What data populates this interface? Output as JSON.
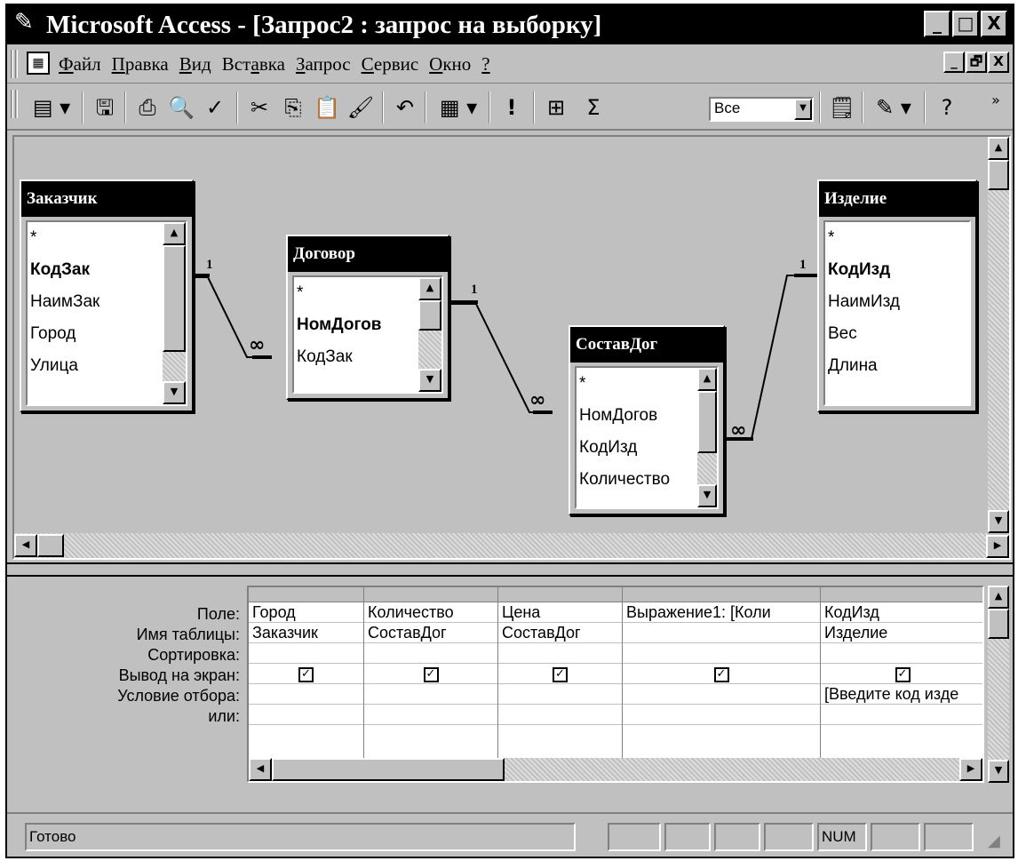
{
  "window": {
    "title": "Microsoft Access - [Запрос2 : запрос на выборку]",
    "caption_buttons": [
      "_",
      "□",
      "X"
    ],
    "mdi_buttons": [
      "_",
      "🗗",
      "X"
    ]
  },
  "menu": {
    "items": [
      {
        "accel": "Ф",
        "rest": "айл"
      },
      {
        "accel": "П",
        "rest": "равка"
      },
      {
        "accel": "В",
        "rest": "ид"
      },
      {
        "pre": "Вст",
        "accel": "а",
        "rest": "вка"
      },
      {
        "accel": "З",
        "rest": "апрос"
      },
      {
        "accel": "С",
        "rest": "ервис"
      },
      {
        "accel": "О",
        "rest": "кно"
      },
      {
        "accel": "?",
        "rest": ""
      }
    ]
  },
  "toolbar": {
    "totals_symbol": "Σ",
    "run_symbol": "!",
    "top_values": "Все",
    "overflow": "»"
  },
  "tables": [
    {
      "title": "Заказчик",
      "fields": [
        {
          "name": "*",
          "key": false
        },
        {
          "name": "КодЗак",
          "key": true
        },
        {
          "name": "НаимЗак",
          "key": false
        },
        {
          "name": "Город",
          "key": false
        },
        {
          "name": "Улица",
          "key": false
        }
      ]
    },
    {
      "title": "Договор",
      "fields": [
        {
          "name": "*",
          "key": false
        },
        {
          "name": "НомДогов",
          "key": true
        },
        {
          "name": "КодЗак",
          "key": false
        }
      ]
    },
    {
      "title": "СоставДог",
      "fields": [
        {
          "name": "*",
          "key": false
        },
        {
          "name": "НомДогов",
          "key": false
        },
        {
          "name": "КодИзд",
          "key": false
        },
        {
          "name": "Количество",
          "key": false
        }
      ]
    },
    {
      "title": "Изделие",
      "fields": [
        {
          "name": "*",
          "key": false
        },
        {
          "name": "КодИзд",
          "key": true
        },
        {
          "name": "НаимИзд",
          "key": false
        },
        {
          "name": "Вес",
          "key": false
        },
        {
          "name": "Длина",
          "key": false
        }
      ]
    }
  ],
  "relations": {
    "one": "1",
    "many": "∞"
  },
  "grid": {
    "row_labels": [
      "Поле:",
      "Имя таблицы:",
      "Сортировка:",
      "Вывод на экран:",
      "Условие отбора:",
      "или:"
    ],
    "columns": [
      {
        "field": "Город",
        "table": "Заказчик",
        "sort": "",
        "show": true,
        "criteria": "",
        "or": ""
      },
      {
        "field": "Количество",
        "table": "СоставДог",
        "sort": "",
        "show": true,
        "criteria": "",
        "or": ""
      },
      {
        "field": "Цена",
        "table": "СоставДог",
        "sort": "",
        "show": true,
        "criteria": "",
        "or": ""
      },
      {
        "field": "Выражение1: [Коли",
        "table": "",
        "sort": "",
        "show": true,
        "criteria": "",
        "or": ""
      },
      {
        "field": "КодИзд",
        "table": "Изделие",
        "sort": "",
        "show": true,
        "criteria": "[Введите код изде",
        "or": ""
      }
    ],
    "check_mark": "✓"
  },
  "statusbar": {
    "text": "Готово",
    "num": "NUM"
  }
}
